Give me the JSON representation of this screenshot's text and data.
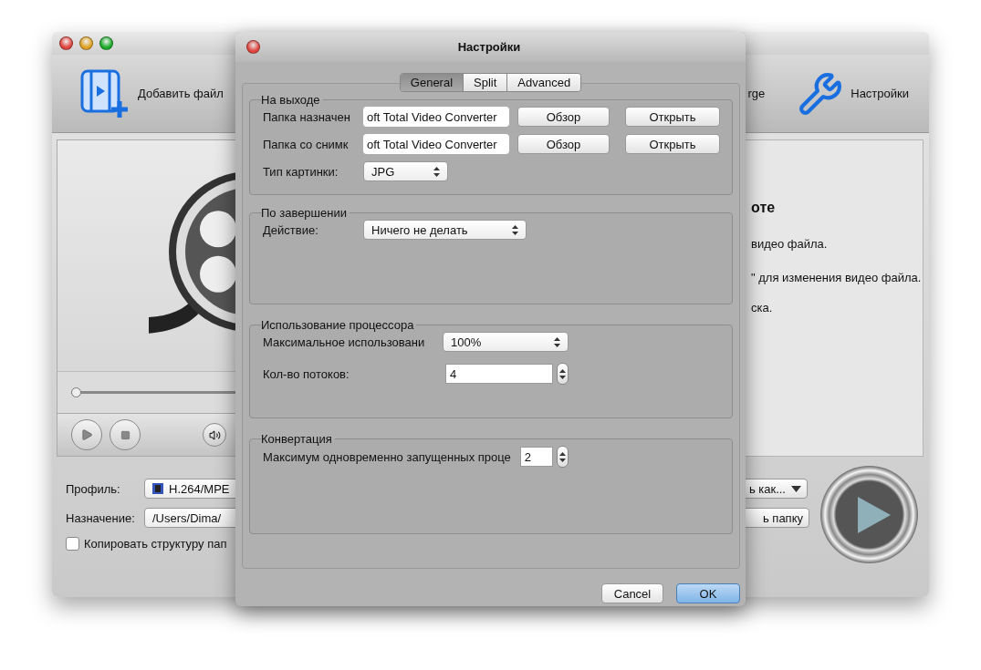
{
  "main_window": {
    "toolbar": [
      {
        "kind": "add",
        "label": "Добавить файл"
      },
      {
        "kind": "partial",
        "label": "rge"
      },
      {
        "kind": "tools",
        "label": "Настройки"
      }
    ],
    "player": {
      "seek": {
        "level": 0
      }
    },
    "guide": {
      "title": "оте",
      "lines": [
        "видео файла.",
        "\" для изменения видео файла.",
        "ска."
      ]
    },
    "output": {
      "profile_label": "Профиль:",
      "profile": "H.264/MPE",
      "save_as_button": "ь как...",
      "destination_label": "Назначение:",
      "destination": "/Users/Dima/",
      "open_folder_button": "ь папку",
      "copy_structure": {
        "label": "Копировать структуру пап",
        "checked": false
      }
    }
  },
  "dialog": {
    "title": "Настройки",
    "tabs": [
      {
        "label": "General",
        "selected": true
      },
      {
        "label": "Split",
        "selected": false
      },
      {
        "label": "Advanced",
        "selected": false
      }
    ],
    "groups": [
      {
        "title": "На выходе",
        "rows": [
          {
            "kind": "path",
            "label": "Папка назначен",
            "value": "oft Total Video Converter",
            "buttons": [
              "Обзор",
              "Открыть"
            ]
          },
          {
            "kind": "path",
            "label": "Папка со снимк",
            "value": "oft Total Video Converter",
            "buttons": [
              "Обзор",
              "Открыть"
            ]
          },
          {
            "kind": "select",
            "label": "Тип картинки:",
            "value": "JPG"
          }
        ]
      },
      {
        "title": "По завершении",
        "rows": [
          {
            "kind": "select",
            "label": "Действие:",
            "value": "Ничего не делать"
          }
        ]
      },
      {
        "title": "Использование процессора",
        "rows": [
          {
            "kind": "select",
            "label": "Максимальное использовани",
            "value": "100%"
          },
          {
            "kind": "stepper",
            "label": "Кол-во потоков:",
            "value": "4"
          }
        ]
      },
      {
        "title": "Конвертация",
        "rows": [
          {
            "kind": "stepper",
            "label": "Максимум одновременно запущенных проце",
            "value": "2"
          }
        ]
      }
    ],
    "buttons": [
      {
        "label": "Cancel",
        "default": false
      },
      {
        "label": "OK",
        "default": true
      }
    ]
  }
}
